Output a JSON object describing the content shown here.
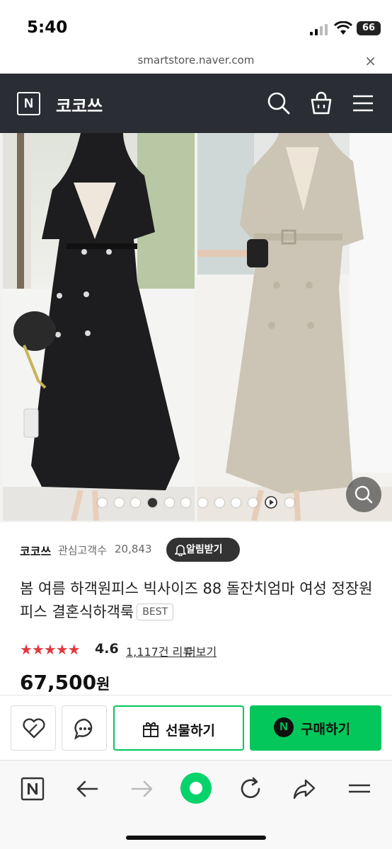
{
  "status_bar": {
    "time": "5:40",
    "battery": "66"
  },
  "browser": {
    "url": "smartstore.naver.com",
    "close_symbol": "×"
  },
  "header": {
    "logo_letter": "N",
    "store_name": "코코쓰",
    "icons": [
      "search-icon",
      "cart-icon",
      "menu-icon"
    ]
  },
  "gallery": {
    "dot_count": 11,
    "active_dot": 4,
    "icons": [
      "zoom-icon",
      "play-icon"
    ]
  },
  "store": {
    "name": "코코쓰",
    "follower_label": "관심고객수",
    "follower_count": "20,843",
    "alarm_button": "알림받기"
  },
  "product": {
    "title": "봄 여름 하객원피스 빅사이즈 88 돌잔치엄마 여성 정장원피스 결혼식하객룩",
    "badge": "BEST",
    "rating": 4.6,
    "rating_text": "4.6",
    "review_count": "1,117건 리뷰",
    "review_more": "더보기",
    "price": "67,500",
    "currency": "원"
  },
  "actions": {
    "gift_label": "선물하기",
    "buy_label": "구매하기",
    "buy_badge": "N",
    "icons": [
      "wish-heart-icon",
      "talk-chat-icon",
      "gift-icon"
    ]
  },
  "colors": {
    "header_bg": "#2a2d33",
    "naver_green": "#03c75a",
    "star_red": "#e03a3e"
  },
  "browser_toolbar": {
    "icons": [
      "naver-home-icon",
      "back-arrow-icon",
      "forward-arrow-icon",
      "green-dot-icon",
      "reload-icon",
      "share-icon",
      "more-menu-icon"
    ]
  }
}
